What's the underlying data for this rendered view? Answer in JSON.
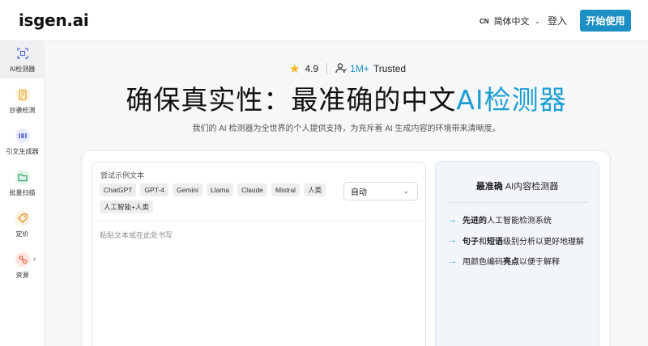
{
  "header": {
    "logo": "isgen.ai",
    "lang_code": "CN",
    "lang_label": "简体中文",
    "login": "登入",
    "start": "开始使用"
  },
  "sidebar": {
    "items": [
      {
        "label": "AI检测器",
        "icon": "scan-icon",
        "color": "#5b6bd6"
      },
      {
        "label": "抄袭检测",
        "icon": "document-icon",
        "color": "#e6a11c"
      },
      {
        "label": "引文生成器",
        "icon": "quote-icon",
        "color": "#4a57c9"
      },
      {
        "label": "批量扫描",
        "icon": "folder-icon",
        "color": "#2e9e5b"
      },
      {
        "label": "定价",
        "icon": "tag-icon",
        "color": "#e08a1c"
      },
      {
        "label": "资源",
        "icon": "resources-icon",
        "color": "#e0552a"
      }
    ]
  },
  "hero": {
    "rating": "4.9",
    "users": "1M+",
    "trusted": "Trusted",
    "title_main": "确保真实性：最准确的中文",
    "title_accent": "AI检测器",
    "subtitle": "我们的 AI 检测器为全世界的个人提供支持，为充斥着 AI 生成内容的环境带来清晰度。"
  },
  "input_panel": {
    "try_label": "尝试示例文本",
    "chips": [
      "ChatGPT",
      "GPT-4",
      "Gemini",
      "Llama",
      "Claude",
      "Mistral",
      "人类",
      "人工智能+人类"
    ],
    "select_value": "自动",
    "placeholder": "粘贴文本或在此处书写"
  },
  "info_panel": {
    "title_bold": "最准确",
    "title_rest": " AI内容检测器",
    "features": [
      {
        "bold": "先进的",
        "rest": " 人工智能检测系统"
      },
      {
        "bold": "句子",
        "mid": "和",
        "bold2": "短语",
        "rest": "级别分析以更好地理解"
      },
      {
        "plain": "用颜色编码",
        "bold": "亮点",
        "rest": "以便于解释"
      }
    ]
  },
  "colors": {
    "accent": "#1c9ed4",
    "button": "#1c8fc4"
  }
}
